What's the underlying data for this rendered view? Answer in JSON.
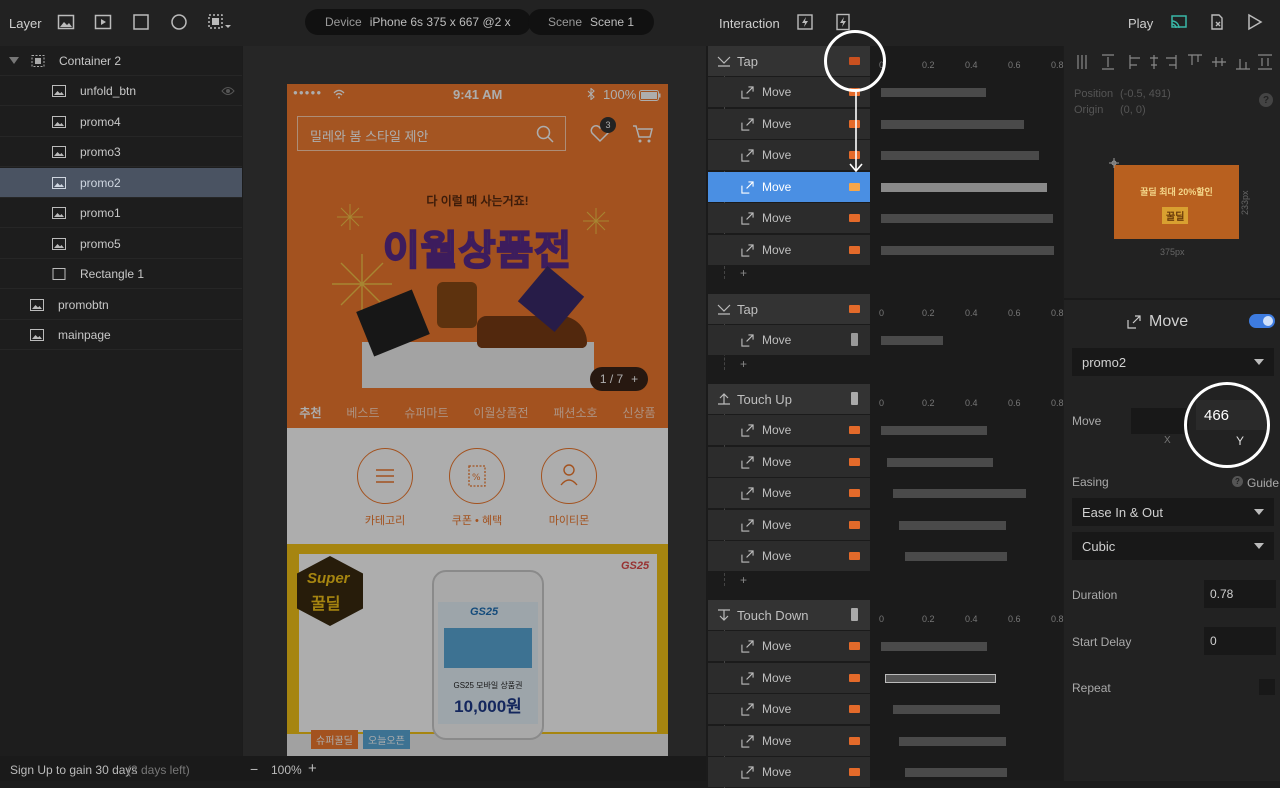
{
  "toolbar": {
    "layer_label": "Layer",
    "device_label": "Device",
    "device_value": "iPhone 6s  375 x 667  @2 x",
    "scene_label": "Scene",
    "scene_value": "Scene 1",
    "interaction_label": "Interaction",
    "play_label": "Play"
  },
  "layers": {
    "items": [
      {
        "label": "Container 2"
      },
      {
        "label": "unfold_btn"
      },
      {
        "label": "promo4"
      },
      {
        "label": "promo3"
      },
      {
        "label": "promo2"
      },
      {
        "label": "promo1"
      },
      {
        "label": "promo5"
      },
      {
        "label": "Rectangle 1"
      },
      {
        "label": "promobtn"
      },
      {
        "label": "mainpage"
      }
    ],
    "selected": "promo2"
  },
  "footer": {
    "signup_text": "Sign Up to gain 30 days",
    "days_left": "(2 days left)",
    "zoom": "100%",
    "zoom_minus": "−",
    "zoom_plus": "+"
  },
  "phone": {
    "carrier_dots": "●●●●●",
    "time": "9:41 AM",
    "battery": "100%",
    "search_placeholder": "밀레와 봄 스타일 제안",
    "cart_badge": "3",
    "banner_subtitle": "다 이럴 때 사는거죠!",
    "banner_title": "이월상품전",
    "banner_pager": "1 / 7",
    "banner_pager_plus": "+",
    "tabs": [
      "추천",
      "베스트",
      "슈퍼마트",
      "이월상품전",
      "패션소호",
      "신상품"
    ],
    "quick_links": [
      "카테고리",
      "쿠폰 • 혜택",
      "마이티몬"
    ],
    "promo_super": "Super",
    "promo_kkul": "꿀딜",
    "promo_gs": "GS25",
    "promo_voucher_line": "GS25 모바일 상품권",
    "promo_voucher_amount": "10,000원",
    "promo_tag1": "슈퍼꿀딜",
    "promo_tag2": "오늘오픈"
  },
  "timeline": {
    "ruler_ticks": [
      "0",
      "0.2",
      "0.4",
      "0.6",
      "0.8"
    ],
    "groups": [
      {
        "trigger": "Tap",
        "actions": [
          "Move",
          "Move",
          "Move",
          "Move",
          "Move",
          "Move"
        ],
        "add": "+"
      },
      {
        "trigger": "Tap",
        "actions": [
          "Move"
        ],
        "add": "+"
      },
      {
        "trigger": "Touch Up",
        "actions": [
          "Move",
          "Move",
          "Move",
          "Move",
          "Move"
        ],
        "add": "+"
      },
      {
        "trigger": "Touch Down",
        "actions": [
          "Move",
          "Move",
          "Move",
          "Move",
          "Move"
        ]
      }
    ]
  },
  "properties": {
    "position_label": "Position",
    "position_value": "(-0.5, 491)",
    "origin_label": "Origin",
    "origin_value": "(0, 0)",
    "preview_text": "꿀딜 최대 20%할인",
    "preview_sub": "꿀딜",
    "preview_width": "375px",
    "preview_height": "233px",
    "action_title": "Move",
    "target": "promo2",
    "move_label": "Move",
    "move_x_label": "X",
    "move_y_label": "Y",
    "move_y_value": "466",
    "easing_label": "Easing",
    "guide_label": "Guide",
    "easing_value": "Ease In & Out",
    "curve_value": "Cubic",
    "duration_label": "Duration",
    "duration_value": "0.78",
    "delay_label": "Start Delay",
    "delay_value": "0",
    "repeat_label": "Repeat",
    "toggle_on": true
  },
  "colors": {
    "selection_blue": "#4a8fe3",
    "promo_orange": "#f07a2e",
    "toggle_blue": "#3d7be0"
  }
}
